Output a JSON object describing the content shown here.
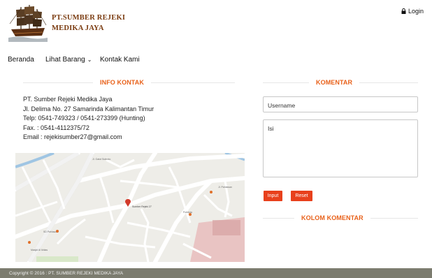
{
  "brand": {
    "line1": "PT.SUMBER REJEKI",
    "line2": "MEDIKA JAYA",
    "logo_icon": "sailing-ship-icon"
  },
  "header": {
    "login_label": "Login",
    "login_icon": "lock-icon"
  },
  "nav": {
    "items": [
      {
        "label": "Beranda"
      },
      {
        "label": "Lihat Barang"
      },
      {
        "label": "Kontak Kami"
      }
    ],
    "dropdown_icon": "chevron-down-icon"
  },
  "info": {
    "title": "INFO KONTAK",
    "company": "PT. Sumber Rejeki Medika Jaya",
    "address": "Jl. Delima No. 27 Samarinda Kalimantan Timur",
    "phone": "Telp: 0541-749323 / 0541-273399 (Hunting)",
    "fax": "Fax. : 0541-4112375/72",
    "email": "Email : rejekisumber27@gmail.com"
  },
  "comment_form": {
    "title": "KOMENTAR",
    "username_placeholder": "Username",
    "message_placeholder": "Isi",
    "submit_label": "Input",
    "reset_label": "Reset"
  },
  "comments": {
    "title": "KOLOM KOMENTAR"
  },
  "footer": {
    "copyright": "Copyright © 2016 : PT. SUMBER REJEKI MEDIKA JAYA"
  },
  "colors": {
    "accent": "#e8611a",
    "button": "#e8401c",
    "brand": "#7a3b10",
    "footer_bg": "#7c7c6f"
  }
}
